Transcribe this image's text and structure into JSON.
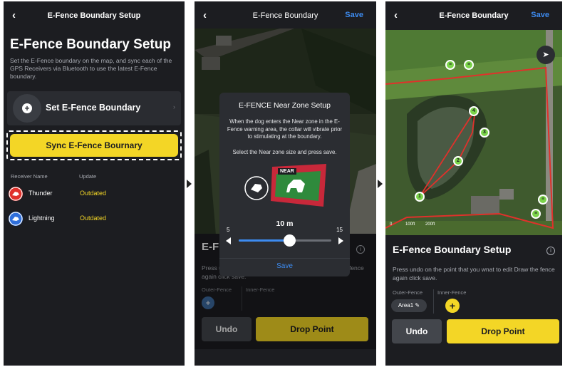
{
  "screen1": {
    "nav_title": "E-Fence Boundary Setup",
    "title": "E-Fence Boundary Setup",
    "description": "Set the E-Fence boundary on the map, and sync each of the GPS Receivers via Bluetooth to use the latest E-Fence boundary.",
    "set_boundary_label": "Set E-Fence Boundary",
    "sync_button_label": "Sync E-Fence Bournary",
    "receiver_header": "Receiver Name",
    "update_header": "Update",
    "receivers": [
      {
        "name": "Thunder",
        "status": "Outdated",
        "color": "#e0312b"
      },
      {
        "name": "Lightning",
        "status": "Outdated",
        "color": "#2f6fdb"
      }
    ]
  },
  "screen2": {
    "nav_title": "E-Fence Boundary",
    "save_label": "Save",
    "modal": {
      "title": "E-FENCE Near Zone Setup",
      "body": "When the dog enters the Near zone in the E-Fence warning area, the collar will vibrate prior to stimulating at the boundary.",
      "instruction": "Select the Near zone size and press save.",
      "near_badge": "NEAR",
      "value": "10 m",
      "min": "5",
      "max": "15",
      "slider_level": 10,
      "save_label": "Save"
    },
    "behind_title": "E-F",
    "behind_text": "Press undo on the point that you wnat to edit Draw the fence again click save.",
    "outer_fence_label": "Outer-Fence",
    "inner_fence_label": "Inner-Fence",
    "undo_label": "Undo",
    "drop_point_label": "Drop Point"
  },
  "screen3": {
    "nav_title": "E-Fence Boundary",
    "save_label": "Save",
    "title": "E-Fence Boundary Setup",
    "instructions": "Press undo on the point that you wnat to edit Draw the fence again click save.",
    "outer_fence_label": "Outer-Fence",
    "inner_fence_label": "Inner-Fence",
    "area_chip": "Area1",
    "undo_label": "Undo",
    "drop_point_label": "Drop Point",
    "scale_labels": [
      "0",
      "100ft",
      "200ft"
    ],
    "point_labels": [
      "1",
      "2",
      "3",
      "4"
    ]
  },
  "colors": {
    "accent_yellow": "#f3d626",
    "accent_blue": "#3d8bf0",
    "background": "#1c1d21",
    "fence_red": "#e0312b",
    "pin_green": "#7bd44a"
  }
}
